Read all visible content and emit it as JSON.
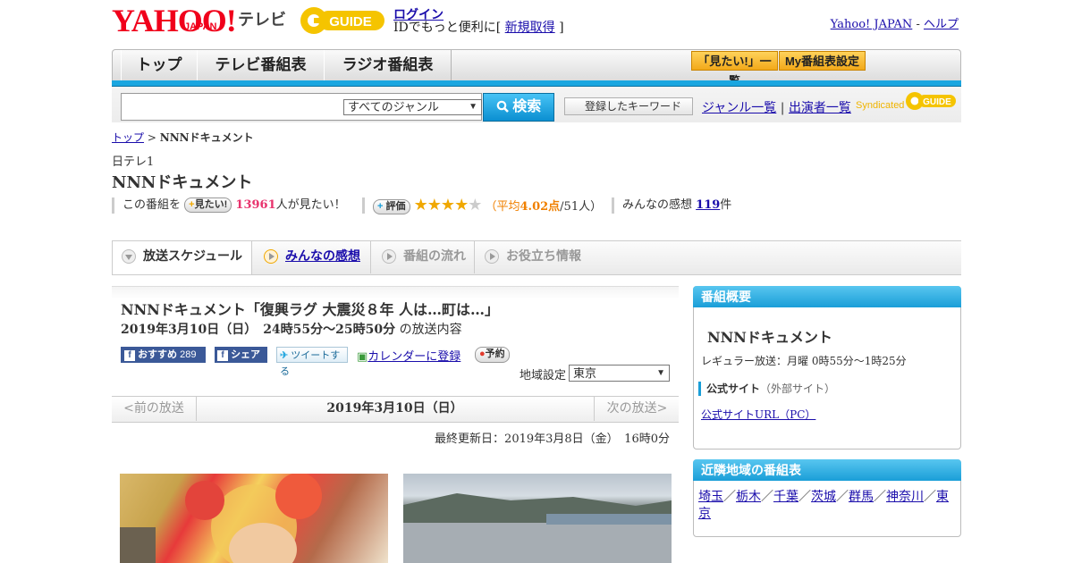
{
  "header": {
    "yahoo_logo": "YAHOO!",
    "japan_logo": "JAPAN",
    "tv_logo": "テレビ",
    "gguide_logo": "GUIDE",
    "login": "ログイン",
    "login_sub_prefix": "IDでもっと便利に[",
    "signup": "新規取得",
    "login_sub_suffix": "]",
    "yahoo_japan": "Yahoo! JAPAN",
    "separator": "-",
    "help": "ヘルプ"
  },
  "nav": {
    "tabs": [
      "トップ",
      "テレビ番組表",
      "ラジオ番組表"
    ],
    "want_list": "「見たい!」一覧",
    "my_schedule": "My番組表設定"
  },
  "search": {
    "placeholder": "",
    "genre_selected": "すべてのジャンル",
    "search_button": "検索",
    "keyword_button": "登録したキーワード",
    "genre_list": "ジャンル一覧",
    "link_separator": "|",
    "performer_list": "出演者一覧",
    "syndicated": "Syndicated"
  },
  "breadcrumb": {
    "top": "トップ",
    "sep": ">",
    "current": "NNNドキュメント"
  },
  "program": {
    "channel": "日テレ1",
    "title": "NNNドキュメント",
    "want_prefix": "この番組を",
    "want_button": "見たい!",
    "want_count": "13961",
    "want_suffix": "人が見たい！",
    "rate_button": "評価",
    "rating": 4.02,
    "rating_text_prefix": "（平均",
    "rating_value": "4.02点",
    "rating_text_suffix": "/51人）",
    "impressions_prefix": "みんなの感想",
    "impressions_count": "119",
    "impressions_suffix": "件"
  },
  "tabs": [
    {
      "label": "放送スケジュール",
      "active": true
    },
    {
      "label": "みんなの感想",
      "active": false
    },
    {
      "label": "番組の流れ",
      "active": false
    },
    {
      "label": "お役立ち情報",
      "active": false
    }
  ],
  "episode": {
    "title": "NNNドキュメント「復興ラグ 大震災８年 人は…町は…」",
    "date_time": "2019年3月10日（日）　24時55分～25時50分",
    "date_suffix": "の放送内容",
    "recommend": "おすすめ",
    "recommend_count": "289",
    "share": "シェア",
    "tweet": "ツイートする",
    "calendar": "カレンダーに登録",
    "reserve": "予約",
    "region_label": "地域設定",
    "region_value": "東京",
    "prev": "<前の放送",
    "current_date": "2019年3月10日（日）",
    "next": "次の放送>",
    "updated": "最終更新日：2019年3月8日（金）　16時0分"
  },
  "sidebar": {
    "overview_header": "番組概要",
    "overview_title": "NNNドキュメント",
    "regular": "レギュラー放送：月曜 0時55分～1時25分",
    "official_label": "公式サイト",
    "official_note": "（外部サイト）",
    "official_link": "公式サイトURL（PC）",
    "nearby_header": "近隣地域の番組表",
    "regions": [
      "埼玉",
      "栃木",
      "千葉",
      "茨城",
      "群馬",
      "神奈川",
      "東京"
    ],
    "region_sep": "／"
  },
  "colors": {
    "accent_blue": "#1aa6e0",
    "brand_red": "#f0001b",
    "orange": "#f2a91a",
    "star": "#f0a800"
  }
}
